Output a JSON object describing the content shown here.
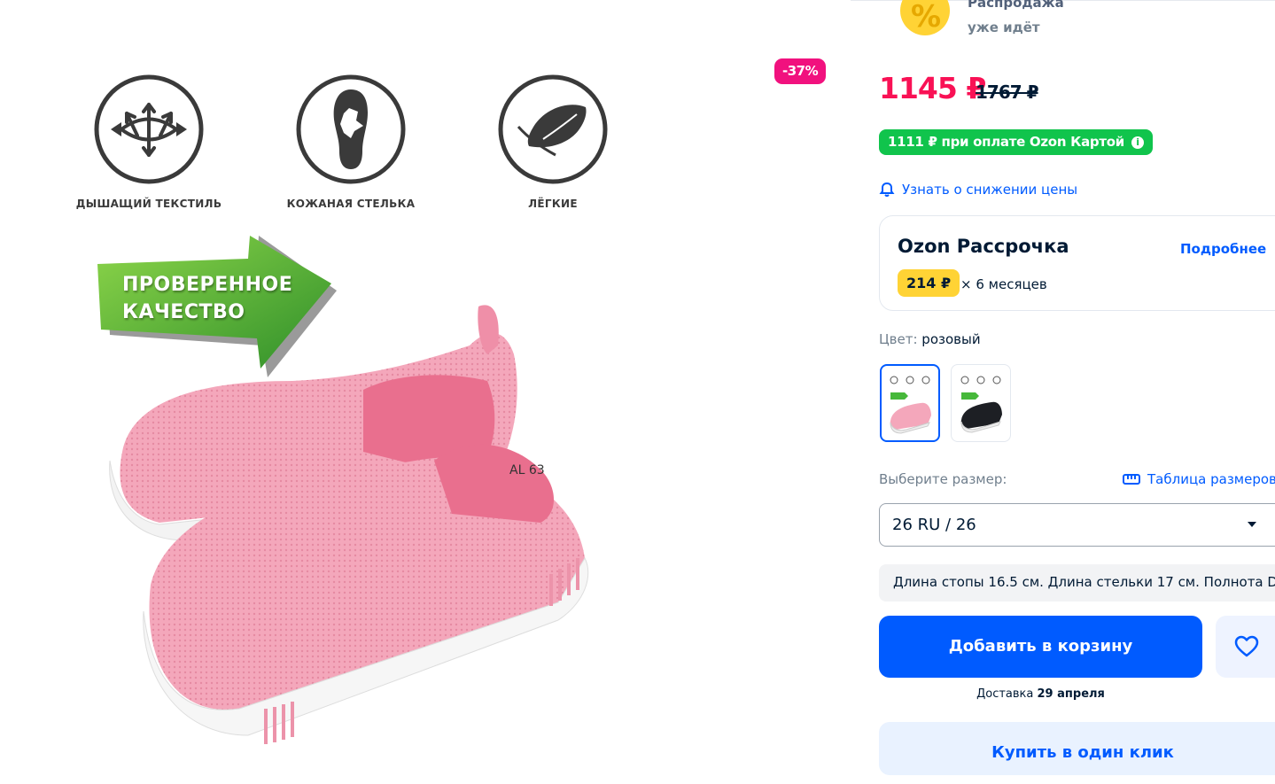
{
  "gallery": {
    "discount_badge": "-37%",
    "features": [
      {
        "label": "ДЫШАЩИЙ ТЕКСТИЛЬ",
        "icon": "arrows-fabric-icon"
      },
      {
        "label": "КОЖАНАЯ СТЕЛЬКА",
        "icon": "insole-icon"
      },
      {
        "label": "ЛЁГКИЕ",
        "icon": "feather-icon"
      }
    ],
    "arrow_text_line1": "ПРОВЕРЕННОЕ",
    "arrow_text_line2": "КАЧЕСТВО",
    "shoe_print": "AL 63"
  },
  "sale_banner": {
    "line1": "Распродажа",
    "line2": "уже идёт"
  },
  "pricing": {
    "price": "1145 ₽",
    "old_price": "1767 ₽",
    "ozon_card_price": "1111 ₽ при оплате Ozon Картой",
    "price_drop_link": "Узнать о снижении цены"
  },
  "installment": {
    "title": "Ozon Рассрочка",
    "more_link": "Подробнее",
    "monthly": "214 ₽",
    "months": "× 6 месяцев"
  },
  "color": {
    "label": "Цвет:",
    "value": "розовый",
    "options": [
      "розовый",
      "черный"
    ]
  },
  "size": {
    "label": "Выберите размер:",
    "table_link": "Таблица размеров",
    "selected": "26 RU / 26",
    "info": "Длина стопы 16.5 см. Длина стельки 17 см. Полнота D"
  },
  "actions": {
    "add_to_cart": "Добавить в корзину",
    "delivery_prefix": "Доставка",
    "delivery_date": "29 апреля",
    "buy_one_click": "Купить в один клик"
  },
  "colors": {
    "accent_blue": "#005bff",
    "price_red": "#f91155",
    "card_green": "#10c44c",
    "badge_yellow": "#ffd335",
    "shoe_pink": "#f4a7bb"
  }
}
